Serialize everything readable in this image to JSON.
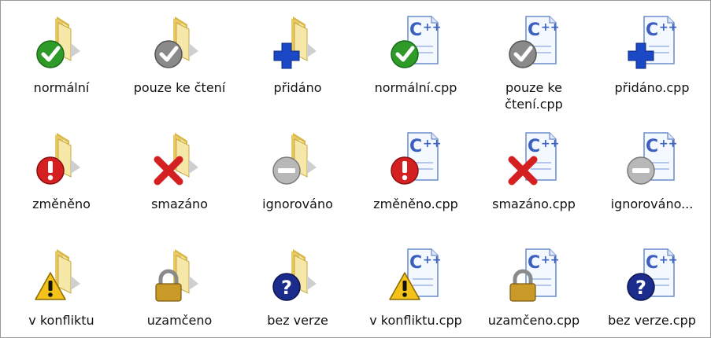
{
  "items": [
    {
      "label": "normální",
      "type": "folder",
      "overlay": "check-green"
    },
    {
      "label": "pouze ke čtení",
      "type": "folder",
      "overlay": "check-gray"
    },
    {
      "label": "přidáno",
      "type": "folder",
      "overlay": "plus-blue"
    },
    {
      "label": "normální.cpp",
      "type": "cpp",
      "overlay": "check-green"
    },
    {
      "label": "pouze ke čtení.cpp",
      "type": "cpp",
      "overlay": "check-gray"
    },
    {
      "label": "přidáno.cpp",
      "type": "cpp",
      "overlay": "plus-blue"
    },
    {
      "label": "změněno",
      "type": "folder",
      "overlay": "exclamation-red"
    },
    {
      "label": "smazáno",
      "type": "folder",
      "overlay": "x-red"
    },
    {
      "label": "ignorováno",
      "type": "folder",
      "overlay": "minus-gray"
    },
    {
      "label": "změněno.cpp",
      "type": "cpp",
      "overlay": "exclamation-red"
    },
    {
      "label": "smazáno.cpp",
      "type": "cpp",
      "overlay": "x-red"
    },
    {
      "label": "ignorováno...",
      "type": "cpp",
      "overlay": "minus-gray"
    },
    {
      "label": "v konfliktu",
      "type": "folder",
      "overlay": "warning-yellow"
    },
    {
      "label": "uzamčeno",
      "type": "folder",
      "overlay": "lock-gold"
    },
    {
      "label": "bez verze",
      "type": "folder",
      "overlay": "question-blue"
    },
    {
      "label": "v konfliktu.cpp",
      "type": "cpp",
      "overlay": "warning-yellow"
    },
    {
      "label": "uzamčeno.cpp",
      "type": "cpp",
      "overlay": "lock-gold"
    },
    {
      "label": "bez verze.cpp",
      "type": "cpp",
      "overlay": "question-blue"
    }
  ],
  "cpp_glyph": "C++",
  "colors": {
    "folder_light": "#f6e8a8",
    "folder_dark": "#d9b84a",
    "green": "#2e9a28",
    "gray": "#8a8a8a",
    "blue": "#1b48c4",
    "red": "#d42020",
    "yellow": "#f2c21a",
    "gold": "#c99a28",
    "navy": "#1c2c8c"
  }
}
